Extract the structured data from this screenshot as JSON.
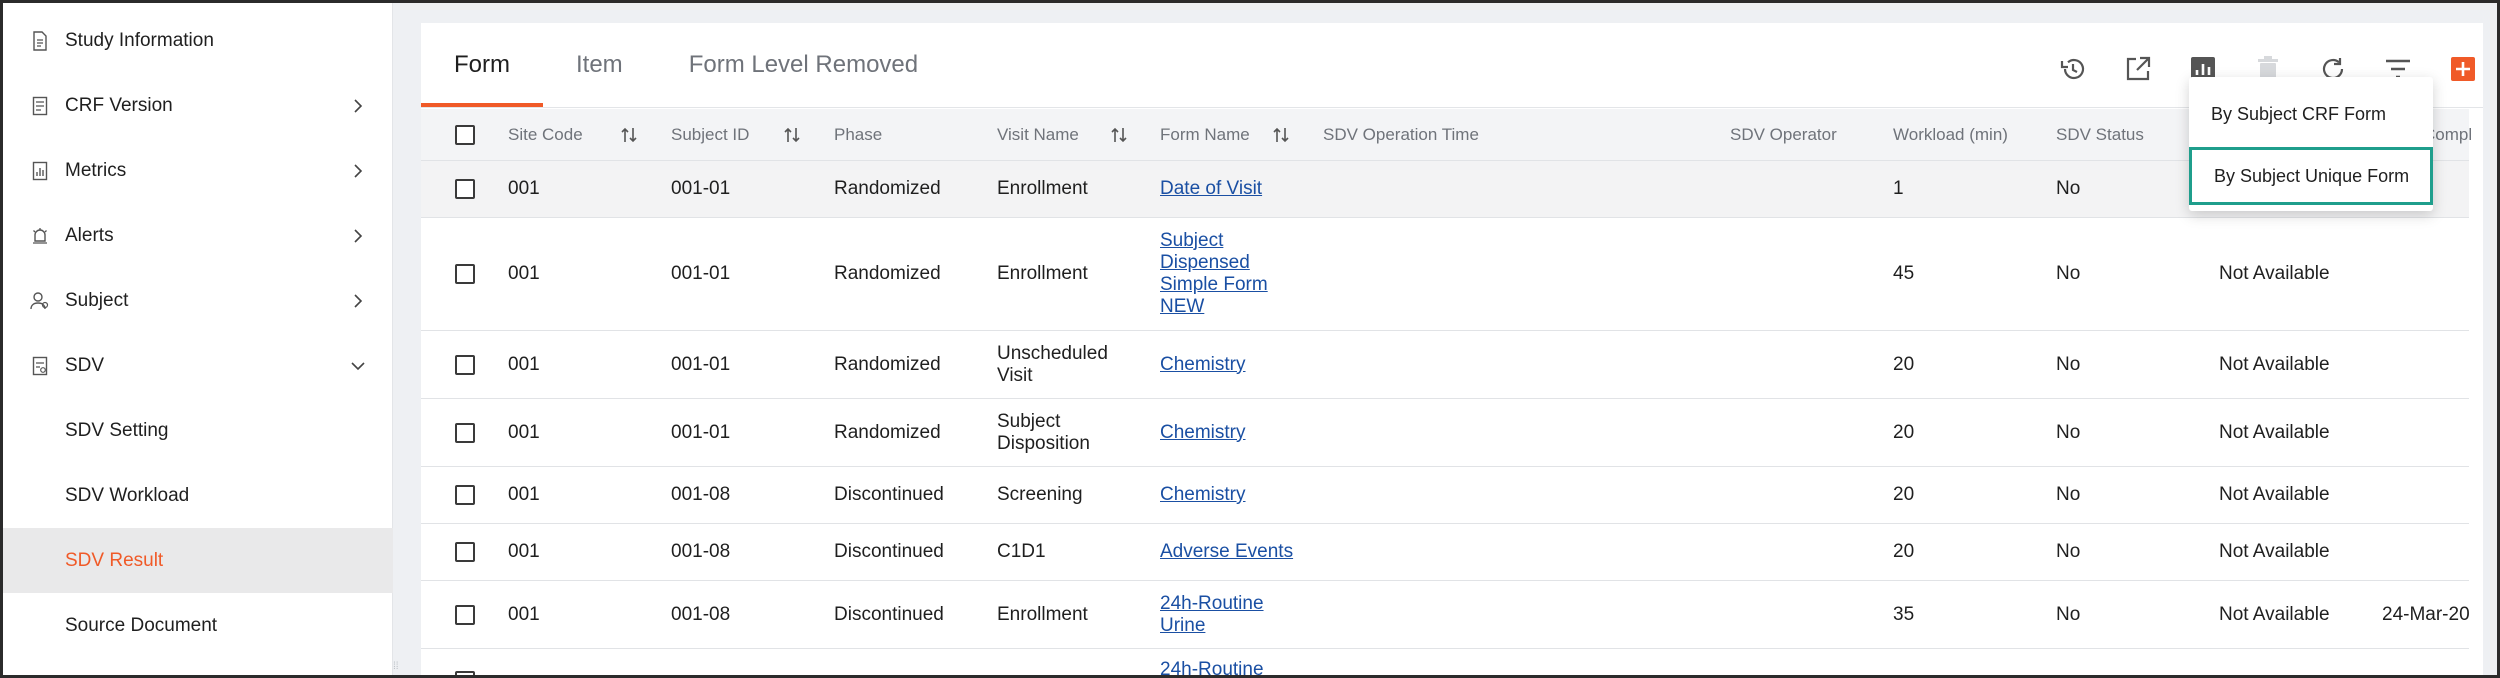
{
  "sidebar": {
    "items": [
      {
        "label": "Study Information",
        "icon": "document-icon",
        "chevron": "none"
      },
      {
        "label": "CRF Version",
        "icon": "form-list-icon",
        "chevron": "right"
      },
      {
        "label": "Metrics",
        "icon": "metrics-icon",
        "chevron": "right"
      },
      {
        "label": "Alerts",
        "icon": "alarm-icon",
        "chevron": "right"
      },
      {
        "label": "Subject",
        "icon": "subject-icon",
        "chevron": "right"
      },
      {
        "label": "SDV",
        "icon": "sdv-icon",
        "chevron": "down"
      }
    ],
    "sub_items": [
      {
        "label": "SDV Setting"
      },
      {
        "label": "SDV Workload"
      },
      {
        "label": "SDV Result",
        "active": true
      },
      {
        "label": "Source Document"
      }
    ]
  },
  "tabs": [
    {
      "label": "Form",
      "active": true
    },
    {
      "label": "Item"
    },
    {
      "label": "Form Level Removed"
    }
  ],
  "toolbar": {
    "icons": [
      "history-icon",
      "open-external-icon",
      "chart-icon",
      "delete-icon",
      "refresh-icon",
      "filter-icon",
      "add-icon"
    ],
    "accent": "#f05a28"
  },
  "table": {
    "columns": [
      {
        "label": "Site Code",
        "sortable": true
      },
      {
        "label": "Subject ID",
        "sortable": true
      },
      {
        "label": "Phase",
        "sortable": false
      },
      {
        "label": "Visit Name",
        "sortable": true
      },
      {
        "label": "Form Name",
        "sortable": true
      },
      {
        "label": "SDV Operation Time",
        "sortable": false
      },
      {
        "label": "SDV Operator",
        "sortable": false
      },
      {
        "label": "Workload (min)",
        "sortable": false
      },
      {
        "label": "SDV Status",
        "sortable": false
      },
      {
        "label": "",
        "sortable": false
      },
      {
        "label": "Compl",
        "sortable": false
      }
    ],
    "rows": [
      {
        "site": "001",
        "subject": "001-01",
        "phase": "Randomized",
        "visit": "Enrollment",
        "form": "Date of Visit",
        "op_time": "",
        "operator": "",
        "workload": "1",
        "status": "No",
        "avail": "",
        "compl": ""
      },
      {
        "site": "001",
        "subject": "001-01",
        "phase": "Randomized",
        "visit": "Enrollment",
        "form": "Subject Dispensed Simple Form NEW",
        "op_time": "",
        "operator": "",
        "workload": "45",
        "status": "No",
        "avail": "Not Available",
        "compl": ""
      },
      {
        "site": "001",
        "subject": "001-01",
        "phase": "Randomized",
        "visit": "Unscheduled Visit",
        "form": "Chemistry",
        "op_time": "",
        "operator": "",
        "workload": "20",
        "status": "No",
        "avail": "Not Available",
        "compl": ""
      },
      {
        "site": "001",
        "subject": "001-01",
        "phase": "Randomized",
        "visit": "Subject Disposition",
        "form": "Chemistry",
        "op_time": "",
        "operator": "",
        "workload": "20",
        "status": "No",
        "avail": "Not Available",
        "compl": ""
      },
      {
        "site": "001",
        "subject": "001-08",
        "phase": "Discontinued",
        "visit": "Screening",
        "form": "Chemistry",
        "op_time": "",
        "operator": "",
        "workload": "20",
        "status": "No",
        "avail": "Not Available",
        "compl": ""
      },
      {
        "site": "001",
        "subject": "001-08",
        "phase": "Discontinued",
        "visit": "C1D1",
        "form": "Adverse Events",
        "op_time": "",
        "operator": "",
        "workload": "20",
        "status": "No",
        "avail": "Not Available",
        "compl": ""
      },
      {
        "site": "001",
        "subject": "001-08",
        "phase": "Discontinued",
        "visit": "Enrollment",
        "form": "24h-Routine Urine",
        "op_time": "",
        "operator": "",
        "workload": "35",
        "status": "No",
        "avail": "Not Available",
        "compl": "24-Mar-20"
      },
      {
        "site": "",
        "subject": "",
        "phase": "",
        "visit": "",
        "form": "24h-Routine",
        "op_time": "",
        "operator": "",
        "workload": "",
        "status": "",
        "avail": "",
        "compl": ""
      }
    ]
  },
  "dropdown": {
    "items": [
      {
        "label": "By Subject CRF Form"
      },
      {
        "label": "By Subject Unique Form",
        "focused": true
      }
    ]
  }
}
